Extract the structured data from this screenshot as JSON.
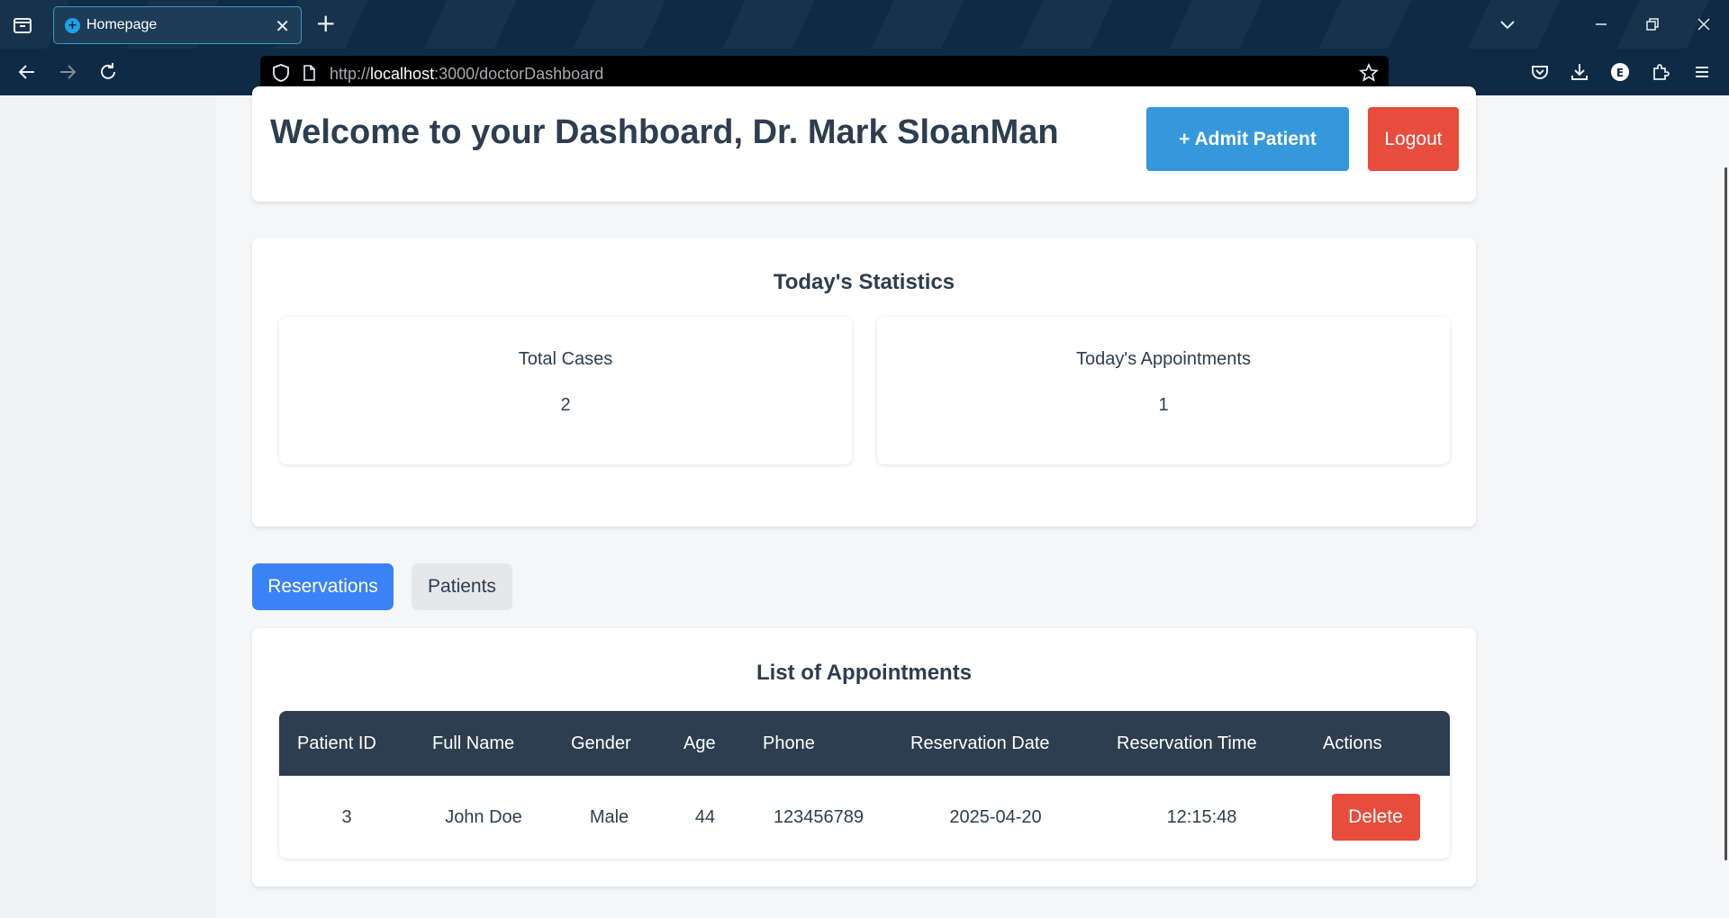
{
  "browser": {
    "tab_title": "Homepage",
    "url_prefix": "http://",
    "url_host": "localhost",
    "url_rest": ":3000/doctorDashboard"
  },
  "header": {
    "title": "Welcome to your Dashboard, Dr. Mark SloanMan",
    "admit_label": "+ Admit Patient",
    "logout_label": "Logout"
  },
  "stats": {
    "title": "Today's Statistics",
    "items": [
      {
        "label": "Total Cases",
        "value": "2"
      },
      {
        "label": "Today's Appointments",
        "value": "1"
      }
    ]
  },
  "tabs": {
    "reservations": "Reservations",
    "patients": "Patients"
  },
  "appointments": {
    "title": "List of Appointments",
    "columns": [
      "Patient ID",
      "Full Name",
      "Gender",
      "Age",
      "Phone",
      "Reservation Date",
      "Reservation Time",
      "Actions"
    ],
    "rows": [
      {
        "id": "3",
        "name": "John Doe",
        "gender": "Male",
        "age": "44",
        "phone": "123456789",
        "date": "2025-04-20",
        "time": "12:15:48",
        "action": "Delete"
      }
    ]
  },
  "colors": {
    "primary": "#3498db",
    "danger": "#e74c3c",
    "tab_active": "#3b82f6",
    "heading": "#2c3e50",
    "browser_bg": "#0f2a44"
  }
}
